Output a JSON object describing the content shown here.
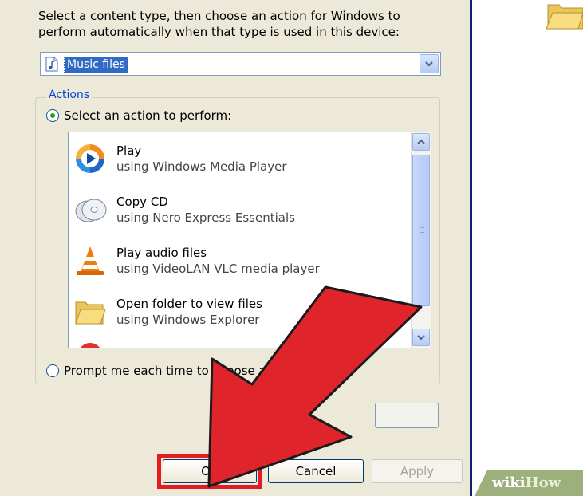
{
  "dialog": {
    "intro_text": "Select a content type, then choose an action for Windows to perform automatically when that type is used in this device:",
    "content_type": {
      "selected": "Music files",
      "icon": "music-file-icon"
    },
    "actions_legend": "Actions",
    "select_action_label": "Select an action to perform:",
    "actions": [
      {
        "title": "Play",
        "subtitle": "using Windows Media Player",
        "icon": "windows-media-player-icon"
      },
      {
        "title": "Copy CD",
        "subtitle": "using Nero Express Essentials",
        "icon": "cd-icon"
      },
      {
        "title": "Play audio files",
        "subtitle": "using VideoLAN VLC media player",
        "icon": "vlc-cone-icon"
      },
      {
        "title": "Open folder to view files",
        "subtitle": "using Windows Explorer",
        "icon": "folder-icon"
      }
    ],
    "prompt_label": "Prompt me each time to choose a",
    "buttons": {
      "ok": "OK",
      "cancel": "Cancel",
      "apply": "Apply"
    }
  },
  "watermark": {
    "wiki": "wiki",
    "how": "How"
  },
  "colors": {
    "highlight": "#e31b23",
    "selection": "#316ac5",
    "dialog_bg": "#ece9d8",
    "legend": "#0046d5"
  }
}
